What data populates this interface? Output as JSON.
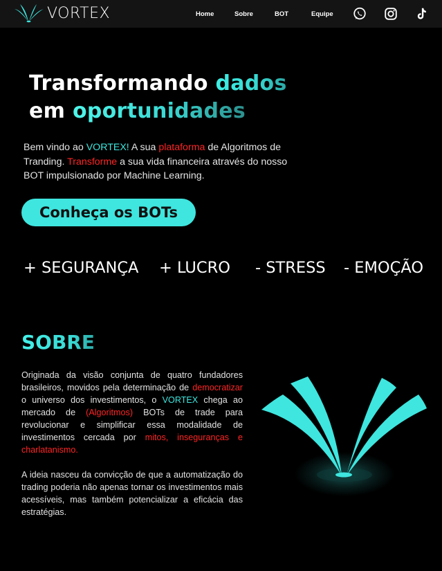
{
  "nav": {
    "brand": "VORTEX",
    "links": [
      "Home",
      "Sobre",
      "BOT",
      "Equipe"
    ],
    "icons": [
      "whatsapp-icon",
      "instagram-icon",
      "tiktok-icon"
    ]
  },
  "hero": {
    "title_line1_plain": "Transformando ",
    "title_line1_accent": "dados",
    "title_line2_plain": "em ",
    "title_line2_accent": "oportunidades",
    "text_1": "Bem vindo ao ",
    "text_2": "VORTEX!",
    "text_3": " A sua ",
    "text_4": "plataforma",
    "text_5": " de Algoritmos de Tranding. ",
    "text_6": "Transforme",
    "text_7": " a sua vida financeira através do nosso BOT impulsionado por Machine Learning.",
    "cta": "Conheça os BOTs"
  },
  "features": [
    "+ SEGURANÇA",
    "+ LUCRO",
    "- STRESS",
    "- EMOÇÃO"
  ],
  "about": {
    "title": "SOBRE",
    "p1_1": "Originada da visão conjunta de quatro fundadores brasileiros, movidos pela determinação de ",
    "p1_2": "democratizar",
    "p1_3": " o universo dos investimentos, o ",
    "p1_4": "VORTEX",
    "p1_5": " chega ao mercado de ",
    "p1_6": "(Algoritmos)",
    "p1_7": " BOTs de trade para revolucionar e simplificar  essa modalidade de investimentos cercada por ",
    "p1_8": "mitos, inseguranças e charlatanismo.",
    "p2": "A ideia nasceu da convicção de que a automatização do trading poderia não apenas tornar os investimentos mais acessíveis, mas também potencializar a eficácia das estratégias."
  },
  "colors": {
    "accent": "#3ee6df",
    "highlight_red": "#ff2424",
    "background": "#000000",
    "navbar": "#141414"
  }
}
